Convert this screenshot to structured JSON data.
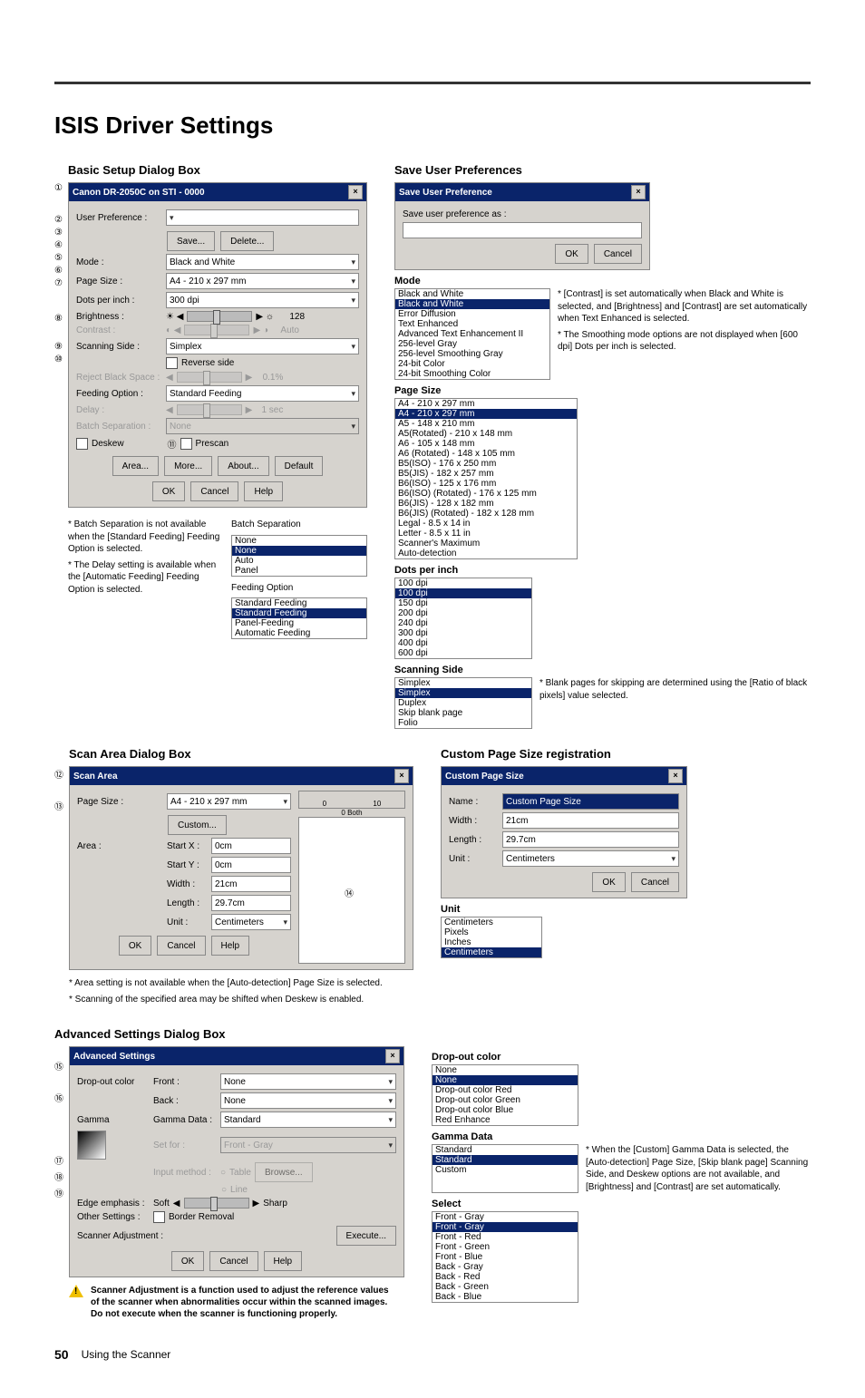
{
  "page": {
    "title": "ISIS Driver Settings",
    "footer_num": "50",
    "footer_text": "Using the Scanner"
  },
  "basic": {
    "heading": "Basic Setup Dialog Box",
    "title": "Canon DR-2050C on STI - 0000",
    "labels": {
      "user_pref": "User Preference :",
      "save": "Save...",
      "delete": "Delete...",
      "mode": "Mode :",
      "page_size": "Page Size :",
      "dpi": "Dots per inch :",
      "brightness": "Brightness :",
      "contrast": "Contrast :",
      "scanning_side": "Scanning Side :",
      "reverse": "Reverse side",
      "reject_black": "Reject Black Space :",
      "feeding": "Feeding Option :",
      "delay": "Delay :",
      "batch_sep": "Batch Separation :",
      "deskew": "Deskew",
      "prescan": "Prescan",
      "area": "Area...",
      "more": "More...",
      "about": "About...",
      "default": "Default",
      "ok": "OK",
      "cancel": "Cancel",
      "help": "Help"
    },
    "values": {
      "mode": "Black and White",
      "page_size": "A4 - 210 x 297 mm",
      "dpi": "300 dpi",
      "bright_val": "128",
      "auto": "Auto",
      "scanning_side": "Simplex",
      "feeding": "Standard Feeding",
      "batch_sep_val": "None",
      "reject_val": "0.1%",
      "delay_val": "1 sec"
    },
    "note_batch": "* Batch Separation is not available when the [Standard Feeding] Feeding Option is selected.",
    "note_delay": "* The Delay setting is available when the [Automatic Feeding] Feeding Option is selected.",
    "mini_batch_title": "Batch Separation",
    "mini_batch_items": [
      "None",
      "None",
      "Auto",
      "Panel"
    ],
    "mini_feed_title": "Feeding Option",
    "mini_feed_items": [
      "Standard Feeding",
      "Standard Feeding",
      "Panel-Feeding",
      "Automatic Feeding"
    ]
  },
  "saveuser": {
    "heading": "Save User Preferences",
    "title": "Save User Preference",
    "label": "Save user preference as :",
    "ok": "OK",
    "cancel": "Cancel"
  },
  "mode_section": {
    "title": "Mode",
    "items": [
      "Black and White",
      "Black and White",
      "Error Diffusion",
      "Text Enhanced",
      "Advanced Text Enhancement II",
      "256-level Gray",
      "256-level Smoothing Gray",
      "24-bit Color",
      "24-bit Smoothing Color"
    ],
    "note1": "* [Contrast] is set automatically when Black and White is selected, and [Brightness] and [Contrast] are set automatically when Text Enhanced is selected.",
    "note2": "* The Smoothing mode options are not displayed when [600 dpi] Dots per inch is selected."
  },
  "pagesize_section": {
    "title": "Page Size",
    "items": [
      "A4 - 210 x 297 mm",
      "A4 - 210 x 297 mm",
      "A5 - 148 x 210 mm",
      "A5(Rotated) - 210 x 148 mm",
      "A6 - 105 x 148 mm",
      "A6 (Rotated) - 148 x 105 mm",
      "B5(ISO) - 176 x 250 mm",
      "B5(JIS) - 182 x 257 mm",
      "B6(ISO) - 125 x 176 mm",
      "B6(ISO) (Rotated) - 176 x 125 mm",
      "B6(JIS) - 128 x 182 mm",
      "B6(JIS) (Rotated) - 182 x 128 mm",
      "Legal - 8.5 x 14 in",
      "Letter - 8.5 x 11 in",
      "Scanner's Maximum",
      "Auto-detection"
    ]
  },
  "dpi_section": {
    "title": "Dots per inch",
    "items": [
      "100 dpi",
      "100 dpi",
      "150 dpi",
      "200 dpi",
      "240 dpi",
      "300 dpi",
      "400 dpi",
      "600 dpi"
    ]
  },
  "scanside_section": {
    "title": "Scanning Side",
    "items": [
      "Simplex",
      "Simplex",
      "Duplex",
      "Skip blank page",
      "Folio"
    ],
    "note": "* Blank pages for skipping are determined using the [Ratio of black pixels] value selected."
  },
  "scanarea": {
    "heading": "Scan Area Dialog Box",
    "title": "Scan Area",
    "labels": {
      "page_size": "Page Size :",
      "custom": "Custom...",
      "area": "Area :",
      "startx": "Start X :",
      "starty": "Start Y :",
      "width": "Width :",
      "length": "Length :",
      "unit": "Unit :",
      "ok": "OK",
      "cancel": "Cancel",
      "help": "Help"
    },
    "values": {
      "page_size": "A4 - 210 x 297 mm",
      "startx": "0cm",
      "starty": "0cm",
      "width": "21cm",
      "length": "29.7cm",
      "unit": "Centimeters",
      "both": "0   Both"
    },
    "note1": "* Area setting is not available when the [Auto-detection] Page Size is selected.",
    "note2": "* Scanning of the specified area may be shifted when Deskew is enabled."
  },
  "custom_reg": {
    "heading": "Custom Page Size registration",
    "title": "Custom Page Size",
    "labels": {
      "name": "Name :",
      "width": "Width :",
      "length": "Length :",
      "unit": "Unit :",
      "ok": "OK",
      "cancel": "Cancel"
    },
    "values": {
      "name": "Custom Page Size",
      "width": "21cm",
      "length": "29.7cm",
      "unit": "Centimeters"
    }
  },
  "unit_section": {
    "title": "Unit",
    "items": [
      "Centimeters",
      "Pixels",
      "Inches",
      "Centimeters"
    ]
  },
  "advanced": {
    "heading": "Advanced Settings Dialog Box",
    "title": "Advanced Settings",
    "labels": {
      "dropout": "Drop-out color",
      "front": "Front :",
      "back": "Back :",
      "gamma": "Gamma",
      "gamma_data": "Gamma Data :",
      "setfor": "Set for :",
      "input_method": "Input method :",
      "table": "Table",
      "browse": "Browse...",
      "line": "Line",
      "edge": "Edge emphasis :",
      "soft": "Soft",
      "sharp": "Sharp",
      "other": "Other Settings :",
      "border": "Border Removal",
      "scanner_adj": "Scanner Adjustment :",
      "execute": "Execute...",
      "ok": "OK",
      "cancel": "Cancel",
      "help": "Help"
    },
    "values": {
      "front": "None",
      "back": "None",
      "gamma": "Standard",
      "setfor": "Front - Gray"
    },
    "warn": "Scanner Adjustment is a function used to adjust the reference values of the scanner when abnormalities occur within the scanned images. Do not execute when the scanner is functioning properly."
  },
  "dropout_section": {
    "title": "Drop-out color",
    "items": [
      "None",
      "None",
      "Drop-out color Red",
      "Drop-out color Green",
      "Drop-out color Blue",
      "Red Enhance"
    ]
  },
  "gamma_section": {
    "title": "Gamma Data",
    "items": [
      "Standard",
      "Standard",
      "Custom"
    ],
    "note": "* When the [Custom] Gamma Data is selected, the [Auto-detection] Page Size, [Skip blank page] Scanning Side, and Deskew options are not available, and [Brightness] and [Contrast] are set automatically."
  },
  "select_section": {
    "title": "Select",
    "items": [
      "Front - Gray",
      "Front - Gray",
      "Front - Red",
      "Front - Green",
      "Front - Blue",
      "Back - Gray",
      "Back - Red",
      "Back - Green",
      "Back - Blue"
    ]
  },
  "circled": [
    "①",
    "②",
    "③",
    "④",
    "⑤",
    "⑥",
    "⑦",
    "⑧",
    "⑨",
    "⑩",
    "⑪",
    "⑫",
    "⑬",
    "⑭",
    "⑮",
    "⑯",
    "⑰",
    "⑱",
    "⑲"
  ]
}
